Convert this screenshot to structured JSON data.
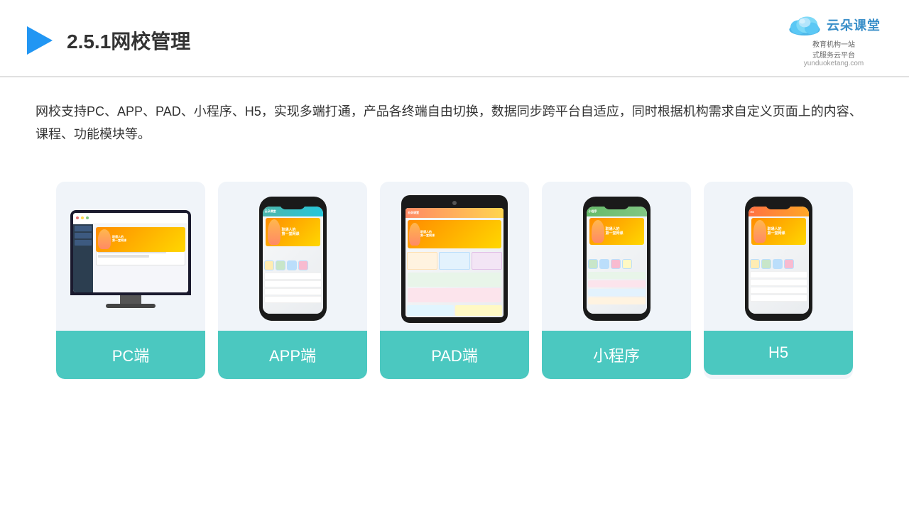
{
  "header": {
    "title": "2.5.1网校管理",
    "logo": {
      "name": "云朵课堂",
      "url": "yunduoketang.com",
      "subtitle": "教育机构一站\n式服务云平台"
    }
  },
  "description": {
    "text": "网校支持PC、APP、PAD、小程序、H5，实现多端打通，产品各终端自由切换，数据同步跨平台自适应，同时根据机构需求自定义页面上的内容、课程、功能模块等。"
  },
  "cards": [
    {
      "id": "pc",
      "label": "PC端"
    },
    {
      "id": "app",
      "label": "APP端"
    },
    {
      "id": "pad",
      "label": "PAD端"
    },
    {
      "id": "miniapp",
      "label": "小程序"
    },
    {
      "id": "h5",
      "label": "H5"
    }
  ]
}
